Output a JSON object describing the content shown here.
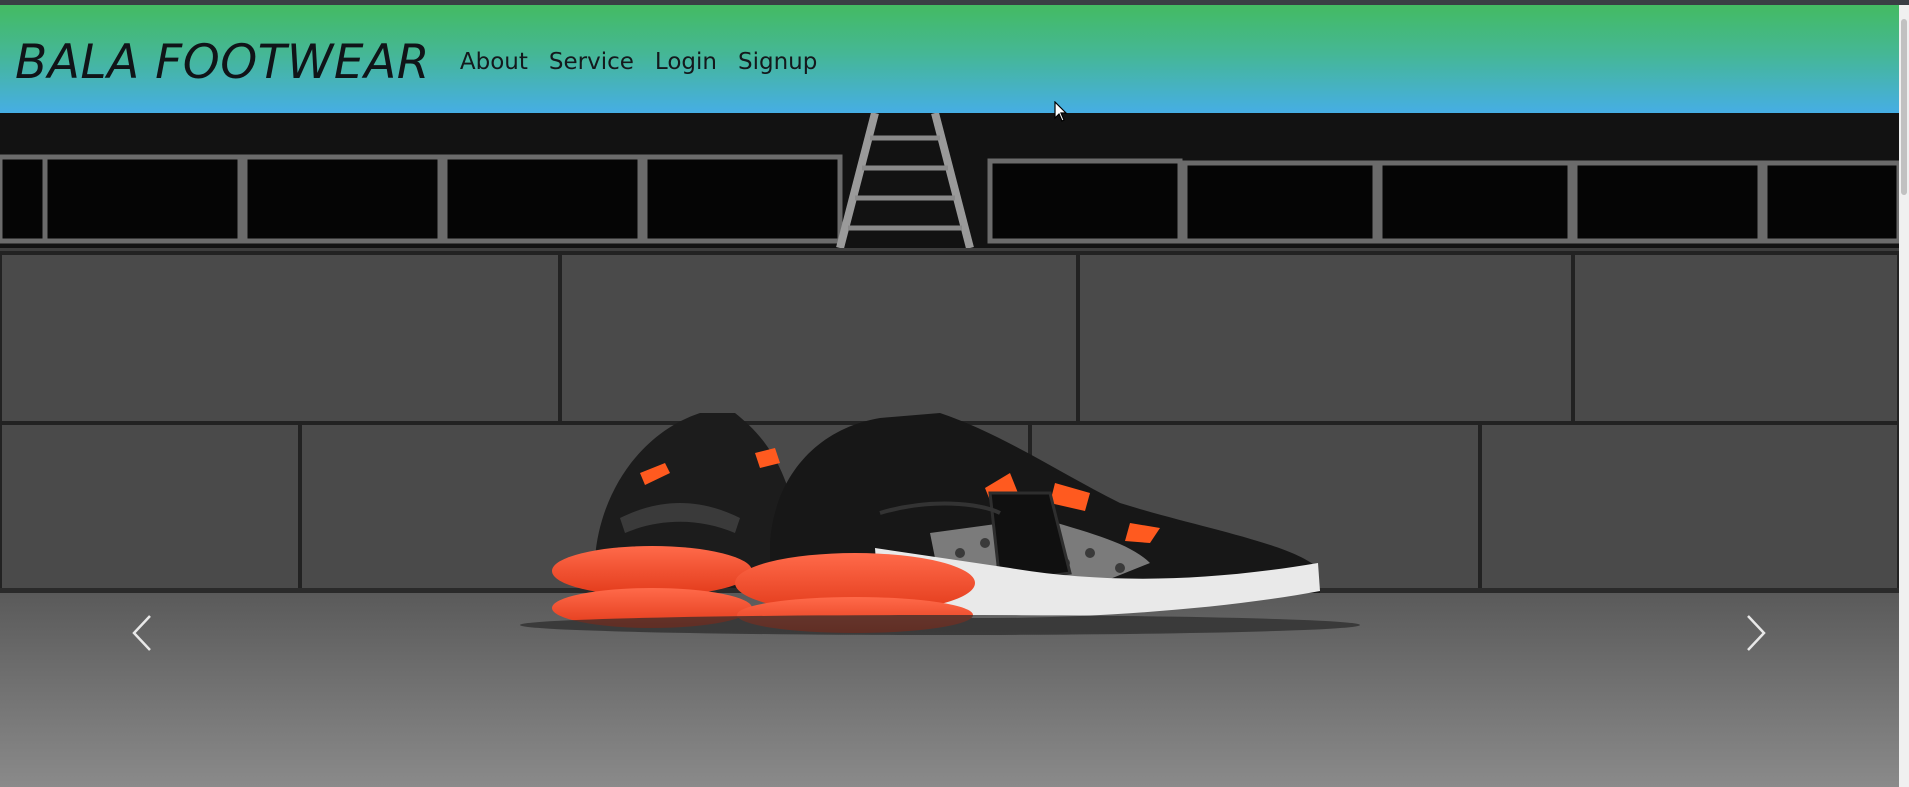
{
  "navbar": {
    "brand": "BALA FOOTWEAR",
    "links": [
      {
        "label": "About"
      },
      {
        "label": "Service"
      },
      {
        "label": "Login"
      },
      {
        "label": "Signup"
      }
    ],
    "gradient_colors": [
      "#44bb62",
      "#46aee4"
    ]
  },
  "carousel": {
    "prev_icon": "chevron-left-icon",
    "next_icon": "chevron-right-icon"
  }
}
